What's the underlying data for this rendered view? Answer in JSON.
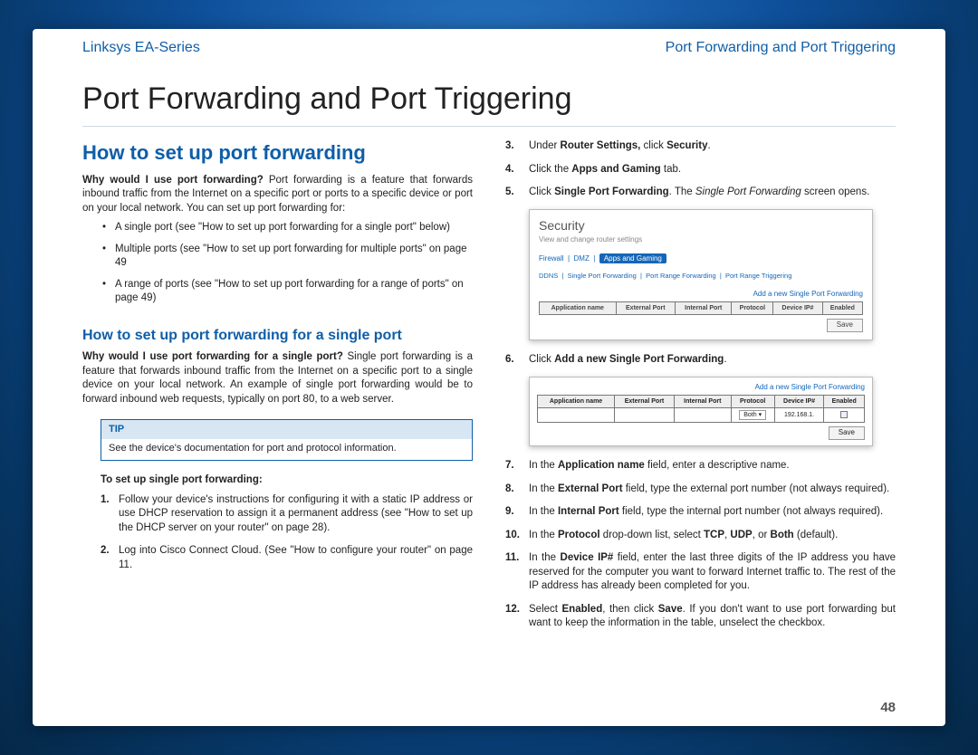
{
  "header": {
    "left": "Linksys EA-Series",
    "right": "Port Forwarding and Port Triggering"
  },
  "main_title": "Port Forwarding and Port Triggering",
  "h2": "How to set up port forwarding",
  "intro_q": "Why would I use port forwarding?",
  "intro_a": " Port forwarding is a feature that forwards inbound traffic from the Internet on a specific port or ports to a specific device or port on your local network. You can set up port forwarding for:",
  "bullets": {
    "b1": "A single port (see \"How to set up port forwarding for a single port\" below)",
    "b2": "Multiple ports (see \"How to set up port forwarding for multiple ports\" on page 49",
    "b3": "A range of ports (see \"How to set up port forwarding for a range of ports\" on page 49)"
  },
  "h3": "How to set up port forwarding for a single port",
  "single_q": "Why would I use port forwarding for a single port?",
  "single_a": " Single port forwarding is a feature that forwards inbound traffic from the Internet on a specific port to a single device on your local network. An example of single port forwarding would be to forward inbound web requests, typically on port 80, to a web server.",
  "tip": {
    "head": "TIP",
    "body": "See the device's documentation for port and protocol information."
  },
  "proc_head": "To set up single port forwarding:",
  "steps_left": {
    "s1": "Follow your device's instructions for configuring it with a static IP address or use DHCP reservation to assign it a permanent address (see \"How to set up the DHCP server on your router\" on page 28).",
    "s2": "Log into Cisco Connect Cloud. (See \"How to configure your router\" on page 11."
  },
  "steps_right": {
    "s3_pre": "Under ",
    "s3_b1": "Router Settings,",
    "s3_mid": " click ",
    "s3_b2": "Security",
    "s3_post": ".",
    "s4_pre": "Click the ",
    "s4_b": "Apps and Gaming",
    "s4_post": " tab.",
    "s5_pre": "Click ",
    "s5_b": "Single Port Forwarding",
    "s5_mid": ". The ",
    "s5_i": "Single Port Forwarding",
    "s5_post": " screen opens.",
    "s6_pre": "Click ",
    "s6_b": "Add a new Single Port Forwarding",
    "s6_post": ".",
    "s7_pre": "In the ",
    "s7_b": "Application name",
    "s7_post": " field, enter a descriptive name.",
    "s8_pre": "In the ",
    "s8_b": "External Port",
    "s8_post": " field, type the external port number (not always required).",
    "s9_pre": "In the ",
    "s9_b": "Internal Port",
    "s9_post": " field, type the internal port number (not always required).",
    "s10_pre": "In the ",
    "s10_b": "Protocol",
    "s10_mid": " drop-down list, select ",
    "s10_b2": "TCP",
    "s10_c": ", ",
    "s10_b3": "UDP",
    "s10_c2": ", or ",
    "s10_b4": "Both",
    "s10_post": " (default).",
    "s11_pre": "In the ",
    "s11_b": "Device IP#",
    "s11_post": " field, enter the last three digits of the IP address you have reserved for the computer you want to forward Internet traffic to. The rest of the IP address has already been completed for you.",
    "s12_pre": "Select ",
    "s12_b": "Enabled",
    "s12_mid": ", then click ",
    "s12_b2": "Save",
    "s12_post": ". If you don't want to use port forwarding but want to keep the information in the table, unselect the checkbox."
  },
  "shot1": {
    "title": "Security",
    "sub": "View and change router settings",
    "tab1": "Firewall",
    "tab2": "DMZ",
    "tab_active": "Apps and Gaming",
    "sub1": "DDNS",
    "sub2": "Single Port Forwarding",
    "sub3": "Port Range Forwarding",
    "sub4": "Port Range Triggering",
    "addlink": "Add a new Single Port Forwarding",
    "th1": "Application name",
    "th2": "External Port",
    "th3": "Internal Port",
    "th4": "Protocol",
    "th5": "Device IP#",
    "th6": "Enabled",
    "save": "Save"
  },
  "shot2": {
    "addlink": "Add a new Single Port Forwarding",
    "th1": "Application name",
    "th2": "External Port",
    "th3": "Internal Port",
    "th4": "Protocol",
    "th5": "Device IP#",
    "th6": "Enabled",
    "proto": "Both",
    "ip": "192.168.1.",
    "save": "Save"
  },
  "page_number": "48"
}
